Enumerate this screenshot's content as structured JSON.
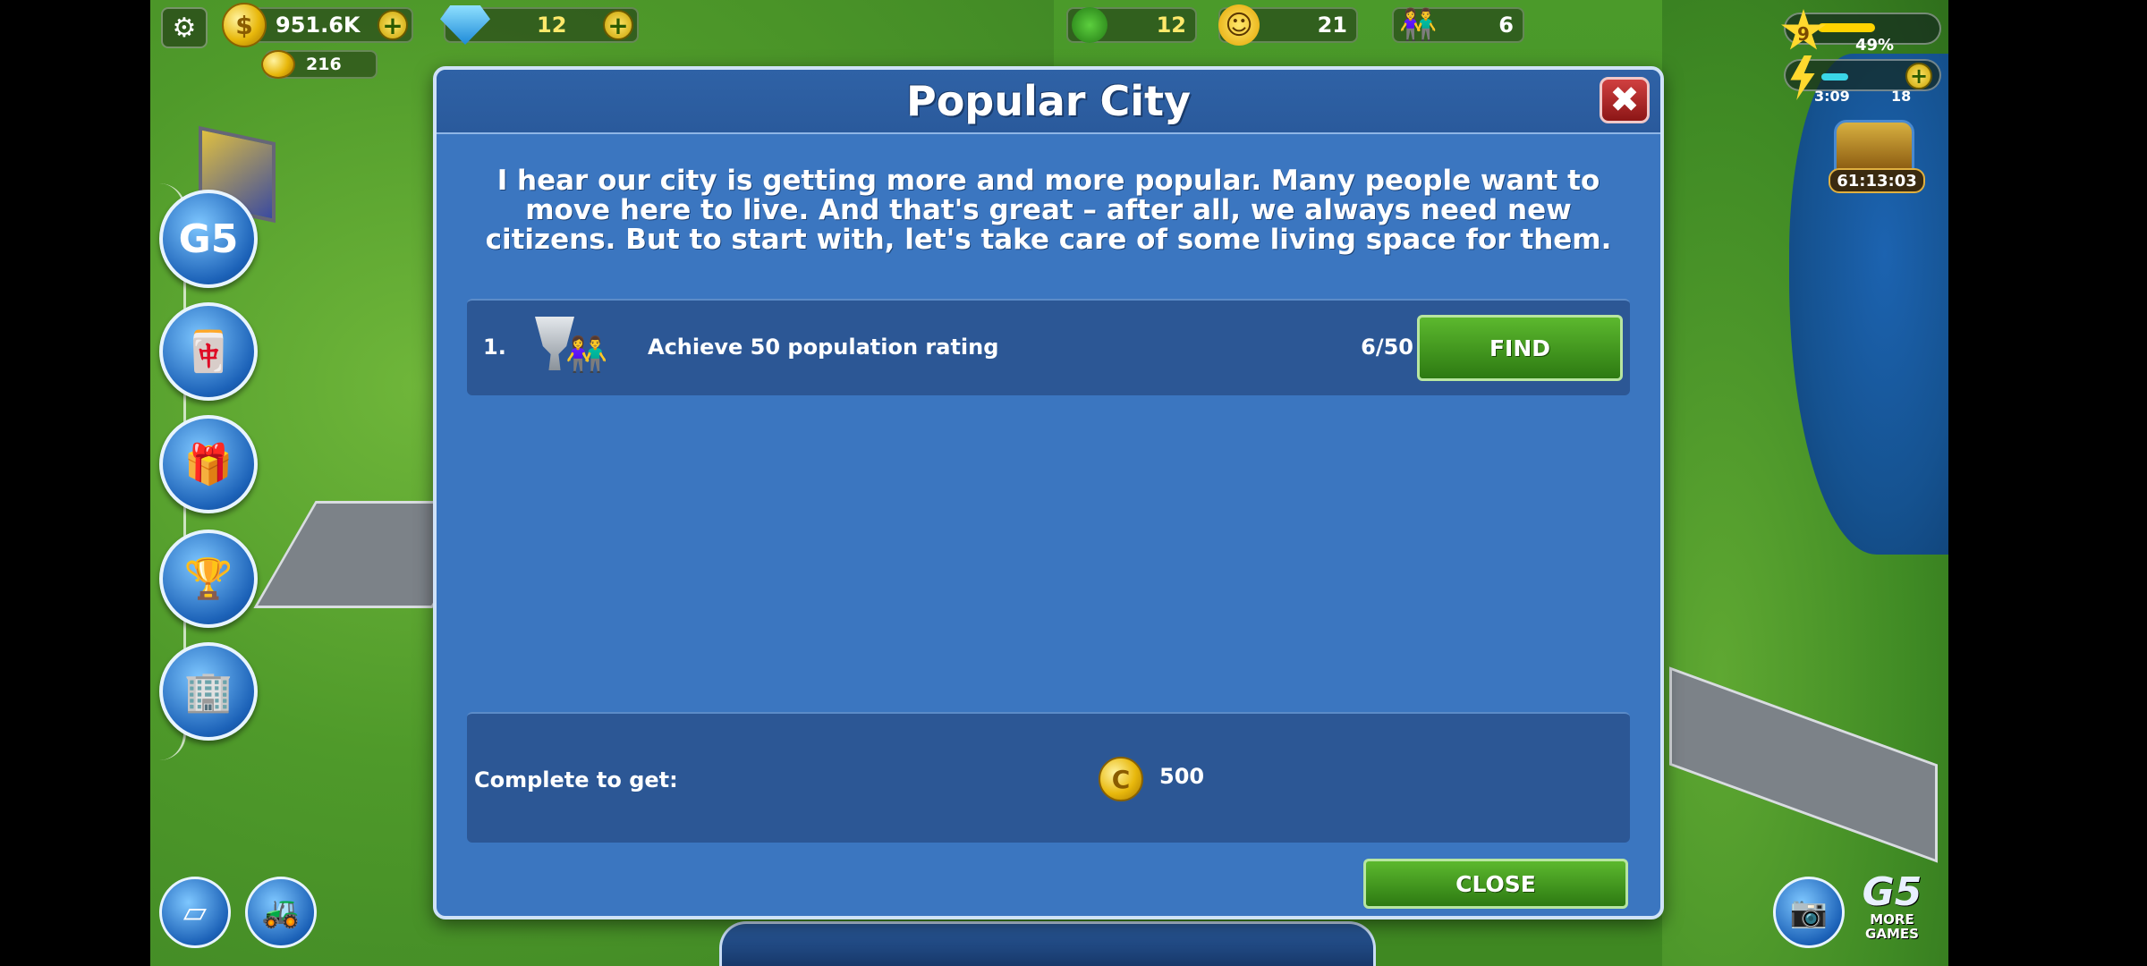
{
  "hud": {
    "coins": "951.6K",
    "gems": "12",
    "bonus": "216",
    "trees": "12",
    "happiness": "21",
    "population": "6",
    "level": "9",
    "level_percent_label": "49%",
    "level_progress": 0.49,
    "energy_timer": "3:09",
    "energy_max": "18",
    "chest_timer": "61:13:03"
  },
  "dialog": {
    "title": "Popular City",
    "intro": "I hear our city is getting more and more popular. Many people want to move here to live. And that's great – after all, we always need new citizens. But to start with, let's take care of some living space for them.",
    "tasks": [
      {
        "number": "1.",
        "text": "Achieve 50 population rating",
        "progress": "6/50",
        "button": "FIND"
      }
    ],
    "reward_label": "Complete to get:",
    "reward_amount": "500",
    "close_button": "CLOSE"
  },
  "more_games": {
    "logo": "G5",
    "line1": "MORE",
    "line2": "GAMES"
  },
  "icons": {
    "settings": "gear-icon",
    "coins": "coin-icon",
    "gems": "gem-icon",
    "trees": "tree-icon",
    "happiness": "smile-icon",
    "population": "people-icon",
    "close": "close-icon",
    "camera": "camera-icon"
  },
  "colors": {
    "dialog_bg": "#3b76c0",
    "button_green": "#2d7a12",
    "close_red": "#8c1616"
  }
}
